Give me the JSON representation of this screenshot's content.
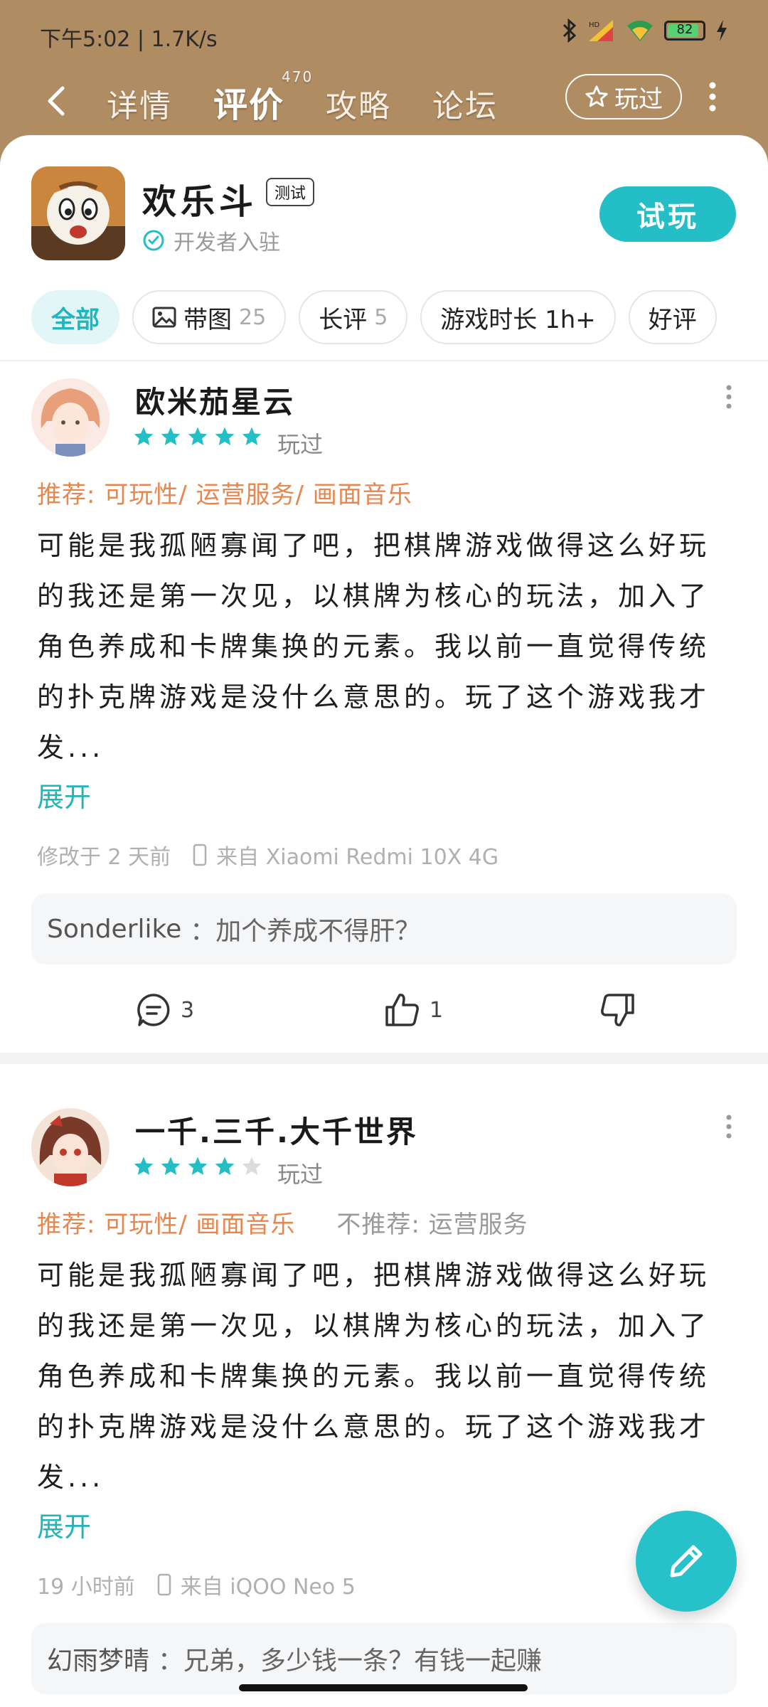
{
  "status_bar": {
    "time_speed": "下午5:02 | 1.7K/s",
    "battery": "82",
    "colors": {
      "battery_fill": "#56d174"
    }
  },
  "nav": {
    "back_icon": "back-arrow-icon",
    "tabs": [
      {
        "label": "详情",
        "active": false
      },
      {
        "label": "评价",
        "active": true,
        "count": "470"
      },
      {
        "label": "攻略",
        "active": false
      },
      {
        "label": "论坛",
        "active": false
      }
    ],
    "played_button": "玩过",
    "more_icon": "more-vertical-icon"
  },
  "game": {
    "name": "欢乐斗",
    "badge": "测试",
    "verified_text": "开发者入驻",
    "try_button": "试玩",
    "colors": {
      "accent": "#24bfc6"
    }
  },
  "filters": [
    {
      "label": "全部",
      "count": "",
      "active": true
    },
    {
      "label": "带图",
      "count": "25",
      "active": false,
      "icon": "image-icon"
    },
    {
      "label": "长评",
      "count": "5",
      "active": false
    },
    {
      "label": "游戏时长 1h+",
      "count": "",
      "active": false
    },
    {
      "label": "好评",
      "count": "",
      "active": false
    }
  ],
  "reviews": [
    {
      "username": "欧米茄星云",
      "rating": 5,
      "played_label": "玩过",
      "recommend": "推荐: 可玩性/ 运营服务/ 画面音乐",
      "not_recommend": "",
      "content": "可能是我孤陋寡闻了吧，把棋牌游戏做得这么好玩的我还是第一次见，以棋牌为核心的玩法，加入了角色养成和卡牌集换的元素。我以前一直觉得传统的扑克牌游戏是没什么意思的。玩了这个游戏我才发...",
      "expand": "展开",
      "time": "修改于 2 天前",
      "device": "来自 Xiaomi Redmi 10X 4G",
      "reply_user": "Sonderlike",
      "reply_text": "：加个养成不得肝？",
      "comments": "3",
      "likes": "1"
    },
    {
      "username": "一千.三千.大千世界",
      "rating": 4,
      "played_label": "玩过",
      "recommend": "推荐: 可玩性/ 画面音乐",
      "not_recommend": "不推荐: 运营服务",
      "content": "可能是我孤陋寡闻了吧，把棋牌游戏做得这么好玩的我还是第一次见，以棋牌为核心的玩法，加入了角色养成和卡牌集换的元素。我以前一直觉得传统的扑克牌游戏是没什么意思的。玩了这个游戏我才发...",
      "expand": "展开",
      "time": "19 小时前",
      "device": "来自 iQOO Neo 5",
      "reply_user": "幻雨梦晴",
      "reply_text": "：兄弟，多少钱一条？有钱一起赚",
      "comments": "",
      "likes": ""
    }
  ],
  "fab_icon": "pencil-icon"
}
